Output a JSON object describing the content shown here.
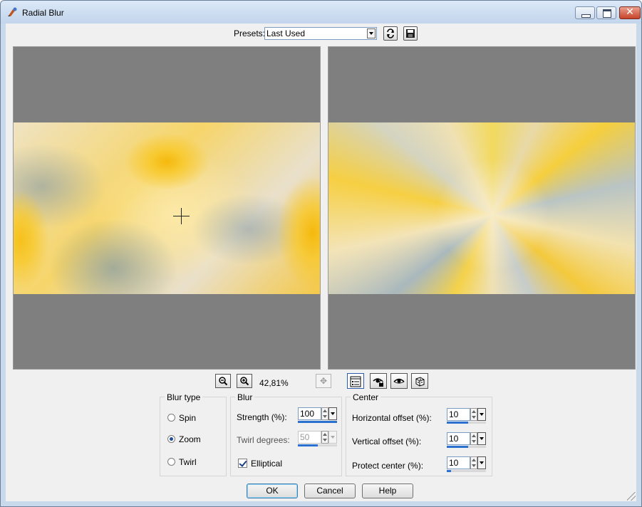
{
  "window": {
    "title": "Radial Blur"
  },
  "presets": {
    "label": "Presets:",
    "value": "Last Used"
  },
  "zoom": {
    "level": "42,81%"
  },
  "blur_type": {
    "title": "Blur type",
    "options": [
      {
        "label": "Spin",
        "checked": false
      },
      {
        "label": "Zoom",
        "checked": true
      },
      {
        "label": "Twirl",
        "checked": false
      }
    ]
  },
  "blur": {
    "title": "Blur",
    "strength_label": "Strength (%):",
    "strength_value": "100",
    "strength_fraction": 1.0,
    "twirl_label": "Twirl degrees:",
    "twirl_value": "50",
    "twirl_fraction": 0.5,
    "elliptical_label": "Elliptical",
    "elliptical_checked": true
  },
  "center": {
    "title": "Center",
    "horizontal_label": "Horizontal offset (%):",
    "horizontal_value": "10",
    "horizontal_fraction": 0.55,
    "vertical_label": "Vertical offset (%):",
    "vertical_value": "10",
    "vertical_fraction": 0.55,
    "protect_label": "Protect center (%):",
    "protect_value": "10",
    "protect_fraction": 0.1
  },
  "buttons": {
    "ok": "OK",
    "cancel": "Cancel",
    "help": "Help"
  },
  "colors": {
    "accent": "#2a71d0",
    "title_bar": "#c9d9ec",
    "preview_bg": "#7f7f7f"
  }
}
